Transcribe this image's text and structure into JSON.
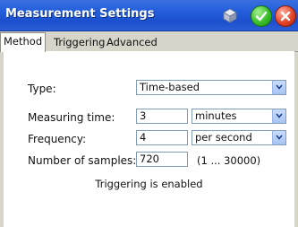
{
  "window": {
    "title": "Measurement Settings"
  },
  "tabs": [
    {
      "label": "Method",
      "active": true
    },
    {
      "label": "Triggering",
      "active": false
    },
    {
      "label": "Advanced",
      "active": false
    }
  ],
  "form": {
    "type": {
      "label": "Type:",
      "value": "Time-based"
    },
    "measuring_time": {
      "label": "Measuring time:",
      "value": "3",
      "unit": "minutes"
    },
    "frequency": {
      "label": "Frequency:",
      "value": "4",
      "unit": "per second"
    },
    "samples": {
      "label": "Number of samples:",
      "value": "720",
      "range": "(1 ... 30000)"
    }
  },
  "status": "Triggering is enabled",
  "colors": {
    "titlebar": "#245fdb",
    "ok_button": "#3bbf2a",
    "close_button": "#e2462a",
    "dropdown_button": "#a8c4f4",
    "window_bg": "#d7d4c9"
  },
  "icons": {
    "settings": "settings-icon",
    "ok": "checkmark-icon",
    "close": "close-icon",
    "dropdown": "chevron-down-icon"
  }
}
